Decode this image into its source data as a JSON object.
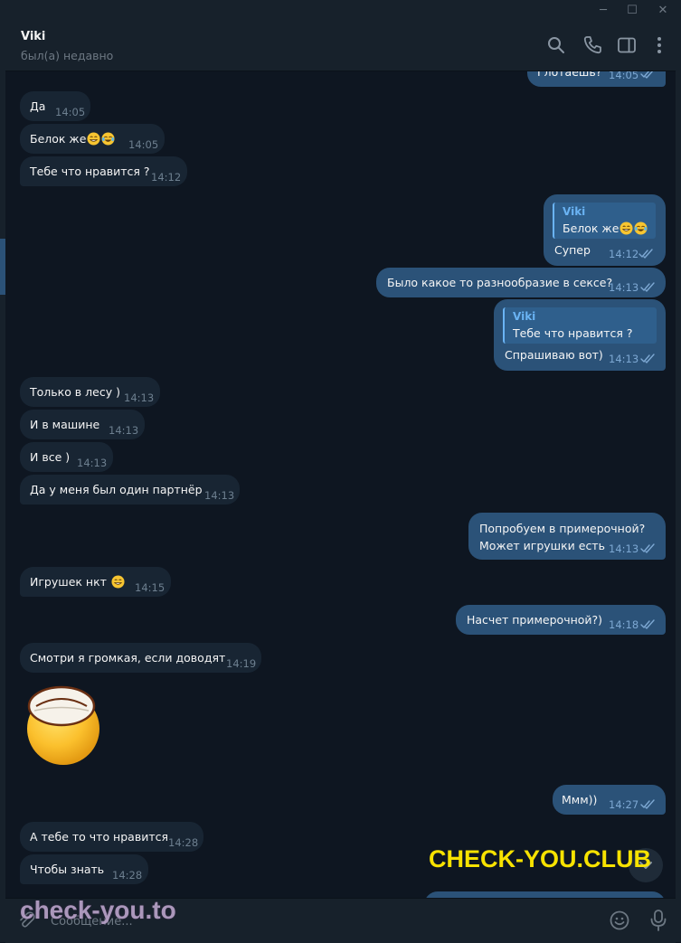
{
  "window": {
    "minimize": "─",
    "maximize": "☐",
    "close": "✕"
  },
  "header": {
    "name": "Viki",
    "status": "был(а) недавно"
  },
  "messages": [
    {
      "dir": "out",
      "text": "Глотаешь?",
      "time": "14:05"
    },
    {
      "dir": "in",
      "text": "Да",
      "time": "14:05"
    },
    {
      "dir": "in",
      "text": "Белок же",
      "emoji": [
        "grin",
        "joy"
      ],
      "time": "14:05"
    },
    {
      "dir": "in",
      "text": "Тебе что нравится ?",
      "time": "14:12"
    },
    {
      "dir": "out",
      "reply": {
        "name": "Viki",
        "text": "Белок же"
      },
      "text": "Супер",
      "time": "14:12"
    },
    {
      "dir": "out",
      "text": "Было какое то разнообразие в сексе?",
      "time": "14:13"
    },
    {
      "dir": "out",
      "reply": {
        "name": "Viki",
        "text": "Тебе что нравится ?"
      },
      "text": "Спрашиваю вот)",
      "time": "14:13"
    },
    {
      "dir": "in",
      "text": "Только в лесу )",
      "time": "14:13"
    },
    {
      "dir": "in",
      "text": "И в машине",
      "time": "14:13"
    },
    {
      "dir": "in",
      "text": "И все )",
      "time": "14:13"
    },
    {
      "dir": "in",
      "text": "Да у меня  был один партнёр",
      "time": "14:13"
    },
    {
      "dir": "out",
      "lines": [
        "Попробуем в примерочной?",
        "Может игрушки есть"
      ],
      "time": "14:13"
    },
    {
      "dir": "in",
      "text": "Игрушек нкт",
      "time": "14:15"
    },
    {
      "dir": "out",
      "text": "Насчет примерочной?)",
      "time": "14:18"
    },
    {
      "dir": "in",
      "text": "Смотри я громкая,  если доводят",
      "time": "14:19"
    },
    {
      "dir": "out",
      "text": "Ммм))",
      "time": "14:27"
    },
    {
      "dir": "in",
      "text": "А тебе то что нравится",
      "time": "14:28"
    },
    {
      "dir": "in",
      "text": "Чтобы знать",
      "time": "14:28"
    }
  ],
  "composer": {
    "placeholder": "Сообщение..."
  },
  "watermarks": {
    "top": "CHECK-YOU.CLUB",
    "bottom": "check-you.to"
  },
  "colors": {
    "bg": "#0e1621",
    "incoming": "#182533",
    "outgoing": "#2b5278",
    "accent": "#6ab3f3"
  },
  "icons": [
    "search-icon",
    "phone-icon",
    "sidebar-toggle-icon",
    "more-icon",
    "attach-icon",
    "emoji-icon",
    "microphone-icon",
    "read-check-icon",
    "sticker-halo-emoji"
  ]
}
